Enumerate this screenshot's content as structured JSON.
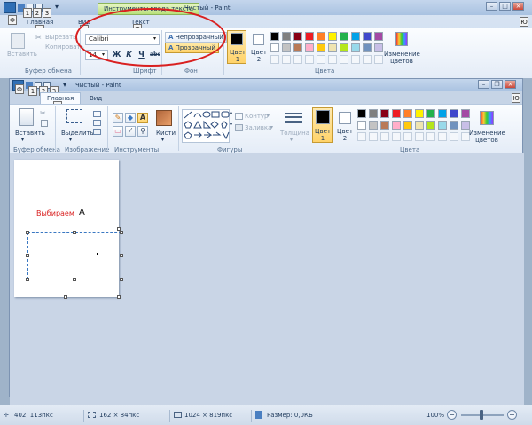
{
  "bg_window": {
    "context_tab": "Инструменты ввода текста",
    "title": "Чистый - Paint",
    "tabs": {
      "home": "Главная",
      "view": "Вид",
      "text": "Текст"
    },
    "keytips": {
      "k1": "1",
      "k2": "2",
      "k3": "3",
      "f": "Ф",
      "g": "Г",
      "v": "В",
      "t": "Т",
      "yu": "Ю"
    },
    "clipboard": {
      "paste": "Вставить",
      "cut": "Вырезать",
      "copy": "Копировать",
      "label": "Буфер обмена"
    },
    "font": {
      "name": "Calibri",
      "size": "14",
      "bold": "Ж",
      "italic": "К",
      "underline": "Ч",
      "strike": "abc",
      "label": "Шрифт"
    },
    "background": {
      "opaque": "Непрозрачный",
      "transparent": "Прозрачный",
      "label": "Фон"
    },
    "colors": {
      "color1": "Цвет 1",
      "color2": "Цвет 2",
      "edit": "Изменение цветов",
      "label": "Цвета"
    }
  },
  "main_window": {
    "title": "Чистый - Paint",
    "tabs": {
      "home": "Главная",
      "view": "Вид"
    },
    "keytips": {
      "f": "Ф",
      "k1": "1",
      "k2": "2",
      "k3": "3",
      "g": "Г",
      "yu": "Ю"
    },
    "groups": {
      "clipboard": "Буфер обмена",
      "image": "Изображение",
      "tools": "Инструменты",
      "shapes": "Фигуры",
      "colors": "Цвета"
    },
    "buttons": {
      "paste": "Вставить",
      "select": "Выделить",
      "brushes": "Кисти",
      "outline": "Контур",
      "fill": "Заливка",
      "thickness": "Толщина",
      "color1": "Цвет 1",
      "color2": "Цвет 2",
      "edit_colors": "Изменение цветов"
    },
    "canvas": {
      "label_text": "Выбираем",
      "letter": "A"
    }
  },
  "statusbar": {
    "cursor": "402, 113пкс",
    "selection": "162 × 84пкс",
    "image_size": "1024 × 819пкс",
    "file_size": "Размер: 0,0КБ",
    "zoom": "100%"
  },
  "palette": [
    "#000000",
    "#7f7f7f",
    "#880015",
    "#ed1c24",
    "#ff7f27",
    "#fff200",
    "#22b14c",
    "#00a2e8",
    "#3f48cc",
    "#a349a4",
    "#ffffff",
    "#c3c3c3",
    "#b97a57",
    "#ffaec9",
    "#ffc90e",
    "#efe4b0",
    "#b5e61d",
    "#99d9ea",
    "#7092be",
    "#c8bfe7"
  ],
  "accent": {
    "annotation": "#d92020",
    "selected": "#ffd36a"
  }
}
